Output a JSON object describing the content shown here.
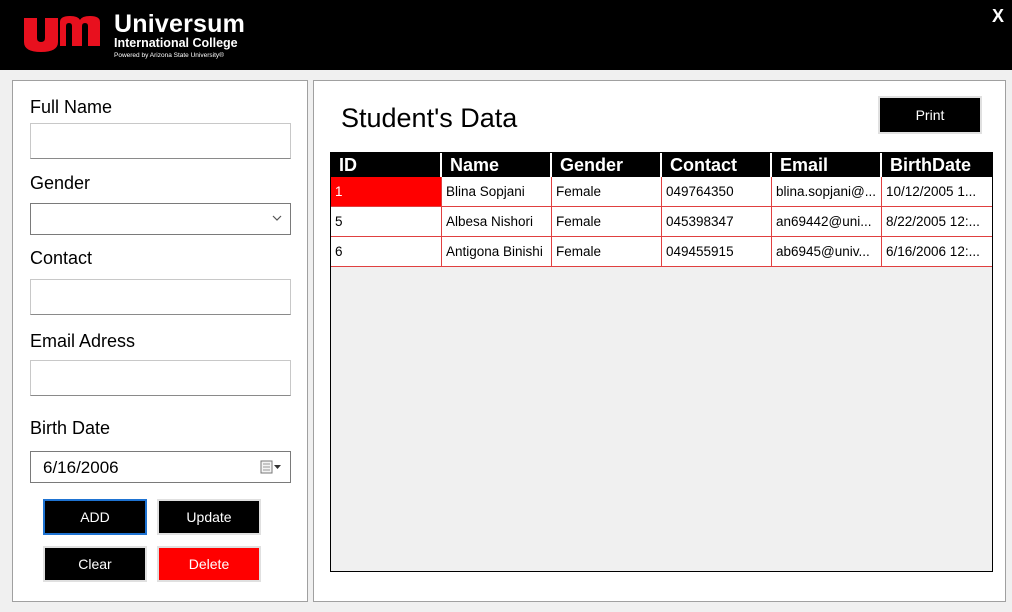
{
  "header": {
    "brand_name": "Universum",
    "brand_sub": "International College",
    "brand_powered": "Powered by Arizona State University®",
    "close_label": "X"
  },
  "form": {
    "full_name_label": "Full Name",
    "full_name_value": "",
    "gender_label": "Gender",
    "gender_value": "",
    "contact_label": "Contact",
    "contact_value": "",
    "email_label": "Email Adress",
    "email_value": "",
    "birth_label": "Birth Date",
    "birth_value": "6/16/2006",
    "add_label": "ADD",
    "update_label": "Update",
    "clear_label": "Clear",
    "delete_label": "Delete"
  },
  "data": {
    "title": "Student's Data",
    "print_label": "Print",
    "columns": [
      "ID",
      "Name",
      "Gender",
      "Contact",
      "Email",
      "BirthDate"
    ],
    "rows": [
      [
        "1",
        "Blina Sopjani",
        "Female",
        "049764350",
        "blina.sopjani@...",
        "10/12/2005 1..."
      ],
      [
        "5",
        "Albesa Nishori",
        "Female",
        "045398347",
        "an69442@uni...",
        "8/22/2005 12:..."
      ],
      [
        "6",
        "Antigona Binishi",
        "Female",
        "049455915",
        "ab6945@univ...",
        "6/16/2006 12:..."
      ]
    ]
  },
  "colors": {
    "accent": "#ff0000",
    "header_bg": "#000000",
    "focus": "#1e73d2"
  }
}
